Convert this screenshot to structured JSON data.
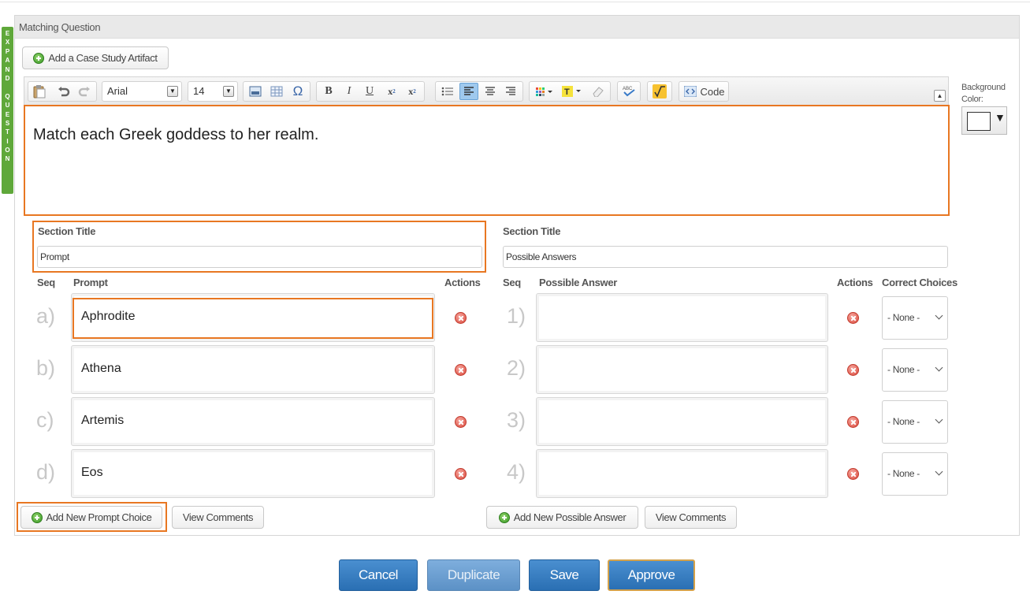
{
  "expand_tab": {
    "letters": [
      "E",
      "X",
      "P",
      "A",
      "N",
      "D",
      "",
      "Q",
      "U",
      "E",
      "S",
      "T",
      "I",
      "O",
      "N"
    ]
  },
  "panel": {
    "title": "Matching Question"
  },
  "add_artifact_label": "Add a Case Study Artifact",
  "toolbar": {
    "font_family": "Arial",
    "font_size": "14",
    "code_label": "Code"
  },
  "editor": {
    "text": "Match each Greek goddess to her realm."
  },
  "background": {
    "label": "Background Color:",
    "color": "#ffffff"
  },
  "prompts": {
    "section_title_label": "Section Title",
    "section_title_value": "Prompt",
    "headers": {
      "seq": "Seq",
      "column": "Prompt",
      "actions": "Actions"
    },
    "items": [
      {
        "seq": "a)",
        "text": "Aphrodite"
      },
      {
        "seq": "b)",
        "text": "Athena"
      },
      {
        "seq": "c)",
        "text": "Artemis"
      },
      {
        "seq": "d)",
        "text": "Eos"
      }
    ],
    "add_label": "Add New Prompt Choice",
    "comments_label": "View Comments"
  },
  "answers": {
    "section_title_label": "Section Title",
    "section_title_value": "Possible Answers",
    "headers": {
      "seq": "Seq",
      "column": "Possible Answer",
      "actions": "Actions",
      "correct": "Correct Choices"
    },
    "items": [
      {
        "seq": "1)",
        "text": "",
        "correct": "- None -"
      },
      {
        "seq": "2)",
        "text": "",
        "correct": "- None -"
      },
      {
        "seq": "3)",
        "text": "",
        "correct": "- None -"
      },
      {
        "seq": "4)",
        "text": "",
        "correct": "- None -"
      }
    ],
    "add_label": "Add New Possible Answer",
    "comments_label": "View Comments"
  },
  "footer": {
    "cancel": "Cancel",
    "duplicate": "Duplicate",
    "save": "Save",
    "approve": "Approve"
  }
}
